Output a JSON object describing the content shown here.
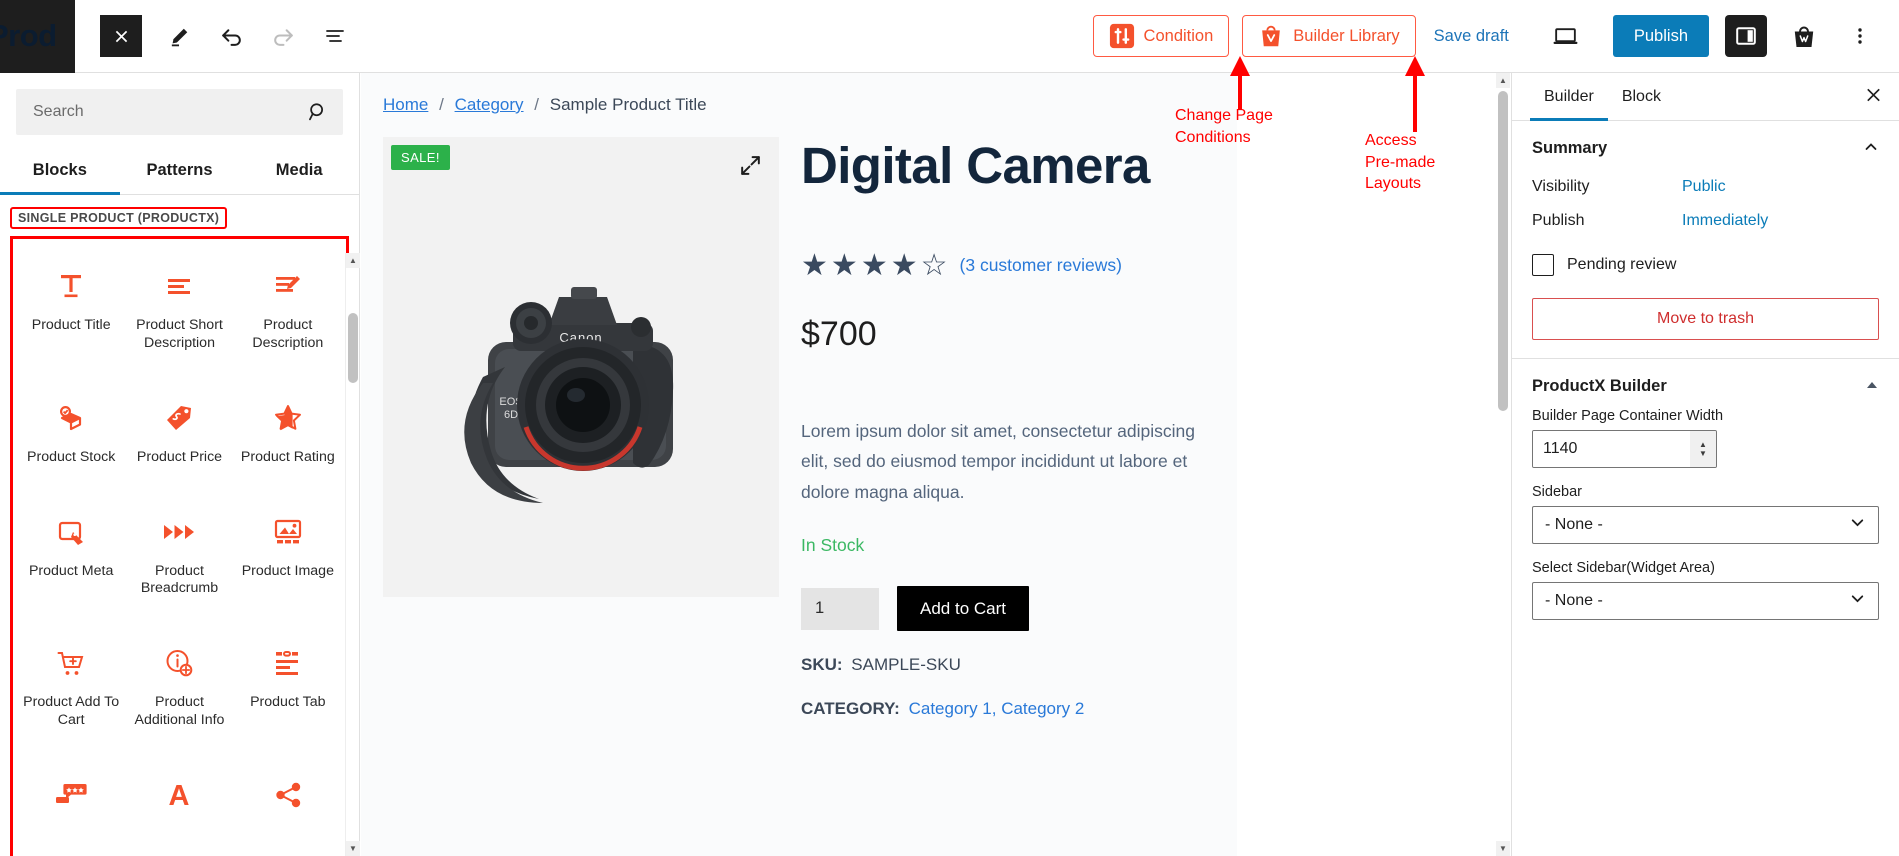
{
  "toolbar": {
    "logo_text": "Prod",
    "close_icon": "close-icon",
    "edit_icon": "pencil-icon",
    "undo_icon": "undo-icon",
    "redo_icon": "redo-icon",
    "list_view_icon": "list-view-icon",
    "condition_label": "Condition",
    "builder_library_label": "Builder Library",
    "save_draft_label": "Save draft",
    "preview_icon": "laptop-preview-icon",
    "publish_label": "Publish",
    "settings_icon": "sidebar-toggle-icon",
    "woo_icon": "woocommerce-bag-icon",
    "more_icon": "more-options-icon"
  },
  "inserter": {
    "search_placeholder": "Search",
    "search_value": "",
    "search_icon": "search-icon",
    "tabs": [
      {
        "label": "Blocks",
        "active": true
      },
      {
        "label": "Patterns",
        "active": false
      },
      {
        "label": "Media",
        "active": false
      }
    ],
    "category_label": "SINGLE PRODUCT (PRODUCTX)",
    "blocks": [
      {
        "label": "Product Title",
        "icon": "text-title-icon"
      },
      {
        "label": "Product Short Description",
        "icon": "short-description-icon"
      },
      {
        "label": "Product Description",
        "icon": "description-edit-icon"
      },
      {
        "label": "Product Stock",
        "icon": "box-check-icon"
      },
      {
        "label": "Product Price",
        "icon": "price-tag-icon"
      },
      {
        "label": "Product Rating",
        "icon": "star-half-icon"
      },
      {
        "label": "Product Meta",
        "icon": "meta-tag-icon"
      },
      {
        "label": "Product Breadcrumb",
        "icon": "triangles-icon"
      },
      {
        "label": "Product Image",
        "icon": "image-gallery-icon"
      },
      {
        "label": "Product Add To Cart",
        "icon": "cart-plus-icon"
      },
      {
        "label": "Product Additional Info",
        "icon": "info-plus-icon"
      },
      {
        "label": "Product Tab",
        "icon": "tab-list-icon"
      },
      {
        "label": "",
        "icon": "review-bubble-icon"
      },
      {
        "label": "",
        "icon": "letter-a-icon"
      },
      {
        "label": "",
        "icon": "share-icon"
      }
    ]
  },
  "canvas": {
    "breadcrumb": {
      "home": "Home",
      "category": "Category",
      "current": "Sample Product Title",
      "separator": "/"
    },
    "sale_badge": "SALE!",
    "expand_icon": "expand-arrows-icon",
    "product": {
      "title": "Digital Camera",
      "rating_stars_filled": 4,
      "rating_stars_total": 5,
      "reviews_link": "(3 customer reviews)",
      "price": "$700",
      "description": "Lorem ipsum dolor sit amet, consectetur adipiscing elit, sed do eiusmod tempor incididunt ut labore et dolore magna aliqua.",
      "stock_status": "In Stock",
      "quantity": "1",
      "add_to_cart_label": "Add to Cart",
      "sku_key": "SKU:",
      "sku_value": "SAMPLE-SKU",
      "category_key": "CATEGORY:",
      "category_value": "Category 1, Category 2"
    }
  },
  "settings": {
    "tabs": [
      {
        "label": "Builder",
        "active": true
      },
      {
        "label": "Block",
        "active": false
      }
    ],
    "close_icon": "close-icon",
    "summary": {
      "title": "Summary",
      "collapse_icon": "chevron-up-icon",
      "rows": [
        {
          "key": "Visibility",
          "value": "Public"
        },
        {
          "key": "Publish",
          "value": "Immediately"
        }
      ],
      "pending_review_label": "Pending review",
      "pending_review_checked": false,
      "move_to_trash_label": "Move to trash"
    },
    "productx_builder": {
      "title": "ProductX Builder",
      "collapse_icon": "chevron-up-icon",
      "container_width_label": "Builder Page Container Width",
      "container_width_value": "1140",
      "sidebar_label": "Sidebar",
      "sidebar_value": "- None -",
      "widget_area_label": "Select Sidebar(Widget Area)",
      "widget_area_value": "- None -"
    }
  },
  "annotations": [
    {
      "text": "Change Page\nConditions"
    },
    {
      "text": "Access\nPre-made\nLayouts"
    }
  ],
  "colors": {
    "accent_orange": "#f4512c",
    "annotation_red": "#ff0000",
    "publish_blue": "#0b7cb8",
    "link_blue": "#2979d8",
    "stock_green": "#3bb863",
    "sale_green": "#2cb14a"
  }
}
